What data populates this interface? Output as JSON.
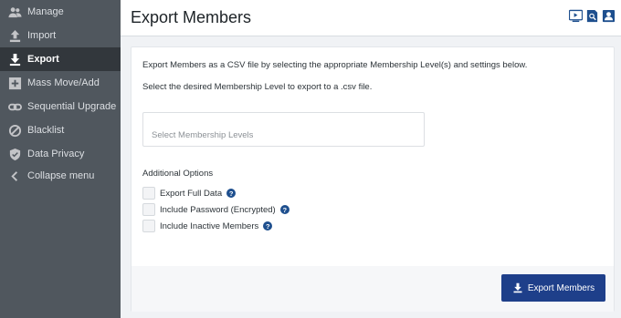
{
  "sidebar": {
    "items": [
      {
        "label": "Manage",
        "icon": "users-icon"
      },
      {
        "label": "Import",
        "icon": "upload-icon"
      },
      {
        "label": "Export",
        "icon": "download-icon",
        "active": true
      },
      {
        "label": "Mass Move/Add",
        "icon": "plus-square-icon"
      },
      {
        "label": "Sequential Upgrade",
        "icon": "link-icon"
      },
      {
        "label": "Blacklist",
        "icon": "ban-icon"
      },
      {
        "label": "Data Privacy",
        "icon": "shield-icon"
      },
      {
        "label": "Collapse menu",
        "icon": "chevron-left-icon"
      }
    ]
  },
  "header": {
    "title": "Export Members",
    "icons": [
      "video-icon",
      "search-doc-icon",
      "user-card-icon"
    ]
  },
  "main": {
    "intro": "Export Members as a CSV file by selecting the appropriate Membership Level(s) and settings below.",
    "select_label": "Select the desired Membership Level to export to a .csv file.",
    "select_placeholder": "Select Membership Levels",
    "options_title": "Additional Options",
    "options": [
      {
        "label": "Export Full Data",
        "checked": false
      },
      {
        "label": "Include Password (Encrypted)",
        "checked": false
      },
      {
        "label": "Include Inactive Members",
        "checked": false
      }
    ],
    "help_glyph": "?",
    "export_button": "Export Members"
  },
  "colors": {
    "sidebar_bg": "#50575e",
    "sidebar_active": "#32373c",
    "accent": "#1e3f8a",
    "help_icon": "#1e4f8e"
  }
}
